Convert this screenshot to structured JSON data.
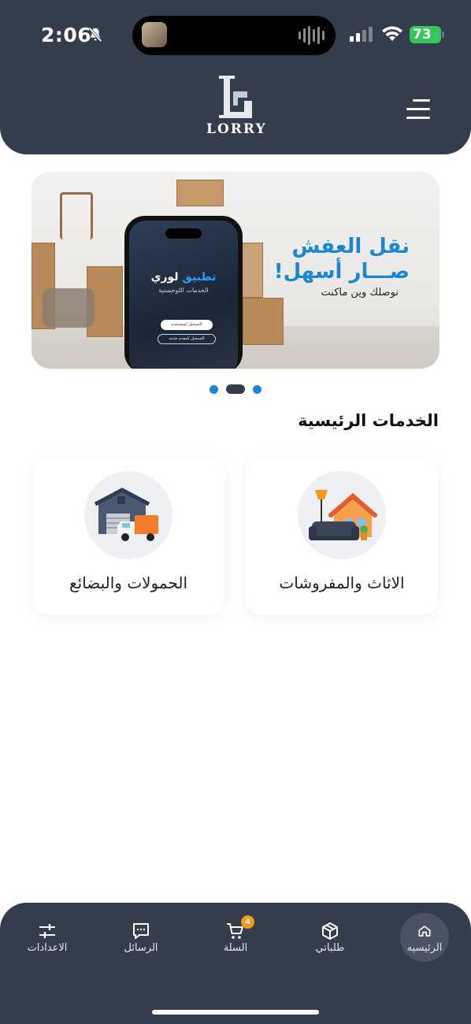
{
  "status_bar": {
    "time": "2:06",
    "battery": "73"
  },
  "header": {
    "logo_text": "LORRY"
  },
  "banner": {
    "headline_1": "نقل العفش",
    "headline_2": "صـــار أسهل!",
    "subline": "نوصلك وين ماكنت",
    "phone_title_blue": "تطبيق",
    "phone_title_white": " لوري",
    "phone_subtitle": "الخدمات اللوجستية",
    "phone_button_1": "التسجيل كمستخدم",
    "phone_button_2": "التسجيل كمقدم خدمة"
  },
  "carousel": {
    "count": 3,
    "active": 2
  },
  "services": {
    "title": "الخدمات الرئيسية",
    "items": [
      {
        "label": "الاثاث والمفروشات",
        "icon": "furniture-icon"
      },
      {
        "label": "الحمولات والبضائع",
        "icon": "cargo-truck-icon"
      }
    ]
  },
  "bottom_nav": {
    "items": [
      {
        "label": "الرئيسيه",
        "icon": "home-icon",
        "active": true
      },
      {
        "label": "طلباتي",
        "icon": "box-icon"
      },
      {
        "label": "السلة",
        "icon": "cart-icon",
        "badge": "4"
      },
      {
        "label": "الرسائل",
        "icon": "chat-icon"
      },
      {
        "label": "الاعدادات",
        "icon": "sliders-icon"
      }
    ]
  },
  "colors": {
    "header": "#343d4c",
    "accent_blue": "#1a86d4",
    "badge": "#f29a1a",
    "battery": "#35c759"
  }
}
